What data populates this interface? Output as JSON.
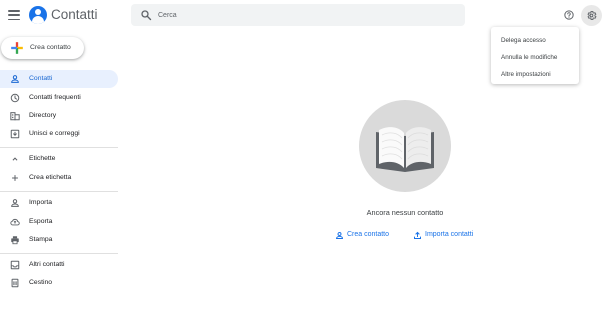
{
  "app": {
    "title": "Contatti"
  },
  "search": {
    "placeholder": "Cerca"
  },
  "settings_menu": {
    "items": [
      "Delega accesso",
      "Annulla le modifiche",
      "Altre impostazioni"
    ]
  },
  "create_button": {
    "label": "Crea contatto"
  },
  "sidebar": {
    "items": [
      {
        "label": "Contatti",
        "icon": "person-icon",
        "active": true
      },
      {
        "label": "Contatti frequenti",
        "icon": "history-icon"
      },
      {
        "label": "Directory",
        "icon": "domain-icon"
      },
      {
        "label": "Unisci e correggi",
        "icon": "merge-icon"
      }
    ],
    "labels_section": {
      "header": "Etichette",
      "create_label": "Crea etichetta"
    },
    "tools": [
      {
        "label": "Importa",
        "icon": "import-icon"
      },
      {
        "label": "Esporta",
        "icon": "cloud-upload-icon"
      },
      {
        "label": "Stampa",
        "icon": "print-icon"
      }
    ],
    "bottom": [
      {
        "label": "Altri contatti",
        "icon": "inbox-icon"
      },
      {
        "label": "Cestino",
        "icon": "trash-icon"
      }
    ]
  },
  "main": {
    "empty_text": "Ancora nessun contatto",
    "actions": [
      {
        "label": "Crea contatto",
        "icon": "person-icon"
      },
      {
        "label": "Importa contatti",
        "icon": "upload-icon"
      }
    ]
  },
  "colors": {
    "accent": "#1a73e8",
    "active_bg": "#e8f0fe",
    "empty_circle": "#dadada"
  }
}
